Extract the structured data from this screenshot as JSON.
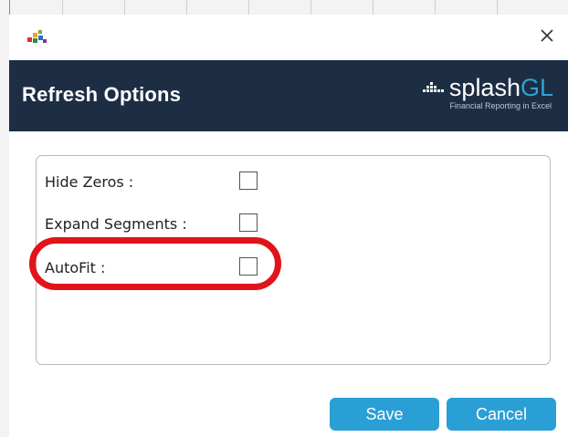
{
  "dialog": {
    "close_glyph": "✕"
  },
  "header": {
    "title": "Refresh Options",
    "logo": {
      "name_prefix": "splash",
      "name_suffix": "GL",
      "tagline": "Financial Reporting in Excel"
    },
    "colors": {
      "band": "#1d2d44",
      "logo_accent": "#2aa4d8"
    }
  },
  "options": [
    {
      "label": "Hide Zeros :",
      "checked": false
    },
    {
      "label": "Expand Segments :",
      "checked": false
    },
    {
      "label": "AutoFit :",
      "checked": false,
      "highlighted": true
    }
  ],
  "buttons": {
    "save_label": "Save",
    "cancel_label": "Cancel",
    "color": "#2a9fd6"
  },
  "annotation": {
    "highlight_color": "#e0141b"
  },
  "icons": {
    "app": "splashgl-app-icon",
    "close": "close-icon",
    "logo_mark": "splashgl-logo-mark-icon"
  }
}
